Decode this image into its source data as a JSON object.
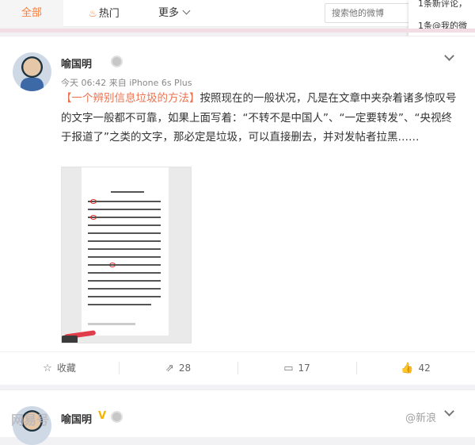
{
  "nav": {
    "tabs": [
      {
        "label": "全部"
      },
      {
        "label": "热门"
      },
      {
        "label": "更多"
      }
    ],
    "search_placeholder": "搜索他的微博"
  },
  "notifications": {
    "comment": "1条新评论，",
    "mention": "1条@我的微"
  },
  "post": {
    "author": "喻国明",
    "meta_time": "今天 06:42",
    "meta_from": "来自",
    "meta_device": "iPhone 6s Plus",
    "tag": "【一个辨别信息垃圾的方法】",
    "body": "按照现在的一般状况，凡是在文章中夹杂着诸多惊叹号的文字一般都不可靠，如果上面写着：“不转不是中国人”、“一定要转发”、“央视终于报道了”之类的文字，那必定是垃圾，可以直接删去，并对发帖者拉黑……",
    "actions": [
      {
        "icon": "star-icon",
        "label": "收藏"
      },
      {
        "icon": "share-icon",
        "label": "28"
      },
      {
        "icon": "comment-icon",
        "label": "17"
      },
      {
        "icon": "like-icon",
        "label": "42"
      }
    ]
  },
  "next_post": {
    "author": "喻国明",
    "v_badge": "V"
  },
  "watermark": {
    "left": "网易号",
    "right": "@新浪"
  },
  "colors": {
    "accent": "#fa7d3c",
    "tag": "#eb7350",
    "verified": "#f5b400"
  }
}
